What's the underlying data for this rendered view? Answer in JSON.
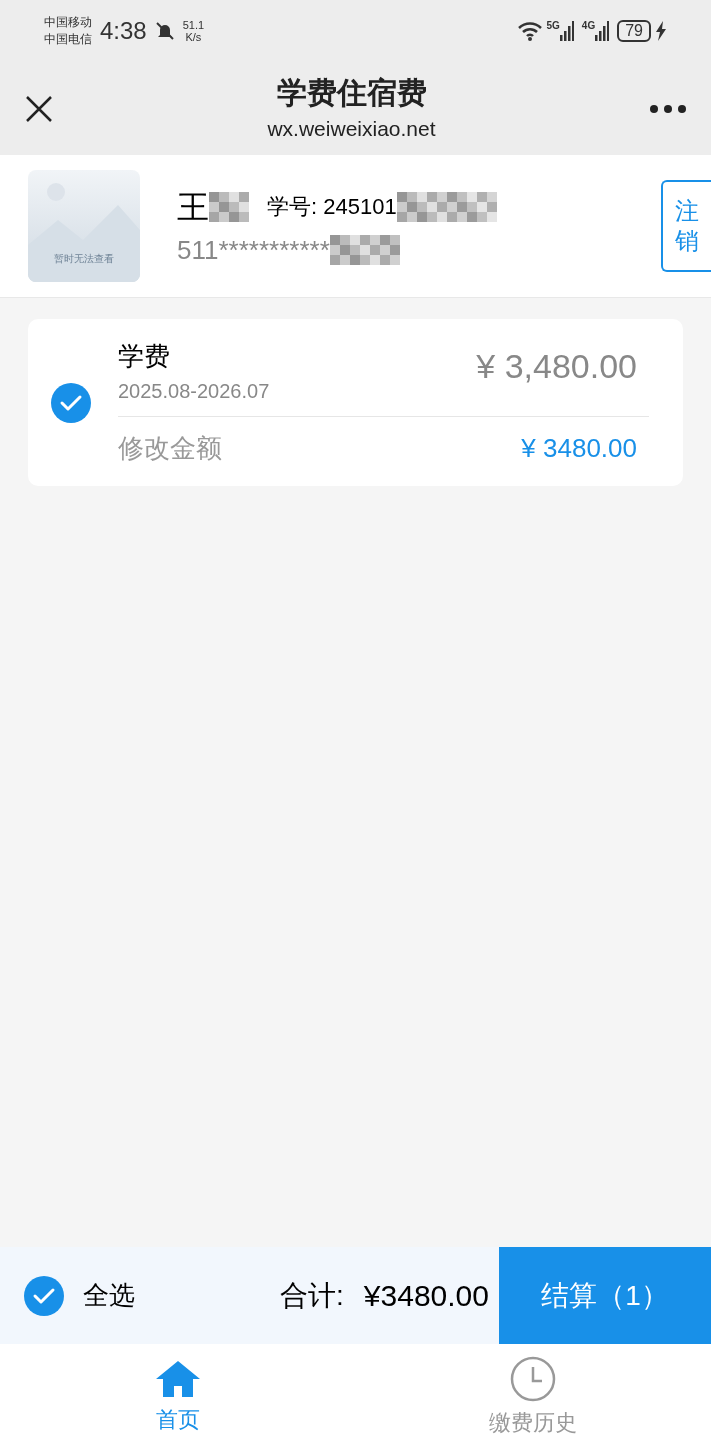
{
  "status_bar": {
    "carrier_1": "中国移动",
    "carrier_2": "中国电信",
    "time": "4:38",
    "speed_value": "51.1",
    "speed_unit": "K/s",
    "network_1": "5G",
    "network_2": "4G",
    "battery": "79"
  },
  "header": {
    "title": "学费住宿费",
    "subtitle": "wx.weiweixiao.net"
  },
  "profile": {
    "photo_caption": "暂时无法查看",
    "name": "王",
    "student_no": "学号: 245101",
    "id_number": "511***********",
    "logout": "注销"
  },
  "fees": [
    {
      "name": "学费",
      "period": "2025.08-2026.07",
      "amount": "¥ 3,480.00",
      "edit_label": "修改金额",
      "edit_amount": "¥ 3480.00",
      "checked": true
    }
  ],
  "footer": {
    "select_all": "全选",
    "select_all_checked": true,
    "total_label": "合计:",
    "total": "¥3480.00",
    "checkout": "结算（1）"
  },
  "tabs": [
    {
      "label": "首页",
      "kind": "home",
      "selected": true
    },
    {
      "label": "缴费历史",
      "kind": "history",
      "selected": false
    }
  ]
}
